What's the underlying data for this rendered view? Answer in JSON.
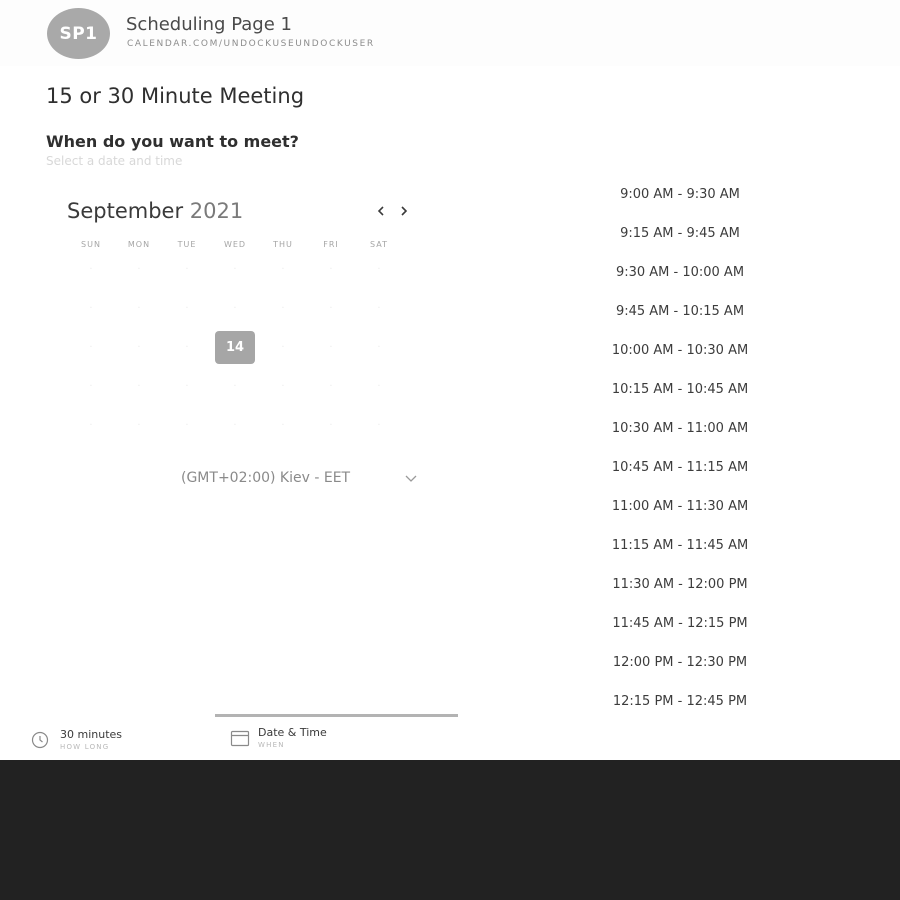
{
  "header": {
    "avatar_initials": "SP1",
    "page_name": "Scheduling Page 1",
    "page_url": "CALENDAR.COM/UNDOCKUSEUNDOCKUSER"
  },
  "meeting": {
    "title": "15 or 30 Minute Meeting",
    "question": "When do you want to meet?",
    "subtitle": "Select a date and time"
  },
  "calendar": {
    "month": "September",
    "year": "2021",
    "weekdays": [
      "SUN",
      "MON",
      "TUE",
      "WED",
      "THU",
      "FRI",
      "SAT"
    ],
    "selected_day": "14"
  },
  "timezone": {
    "label": "(GMT+02:00) Kiev - EET"
  },
  "slots": [
    "9:00 AM - 9:30 AM",
    "9:15 AM - 9:45 AM",
    "9:30 AM - 10:00 AM",
    "9:45 AM - 10:15 AM",
    "10:00 AM - 10:30 AM",
    "10:15 AM - 10:45 AM",
    "10:30 AM - 11:00 AM",
    "10:45 AM - 11:15 AM",
    "11:00 AM - 11:30 AM",
    "11:15 AM - 11:45 AM",
    "11:30 AM - 12:00 PM",
    "11:45 AM - 12:15 PM",
    "12:00 PM - 12:30 PM",
    "12:15 PM - 12:45 PM"
  ],
  "steps": [
    {
      "label": "30 minutes",
      "sub": "HOW LONG",
      "icon": "clock-icon"
    },
    {
      "label": "Date & Time",
      "sub": "WHEN",
      "icon": "calendar-icon"
    }
  ],
  "colors": {
    "selected_day_bg": "#a6a6a6",
    "footer_bg": "#222222",
    "progress": "#b3b3b3"
  }
}
